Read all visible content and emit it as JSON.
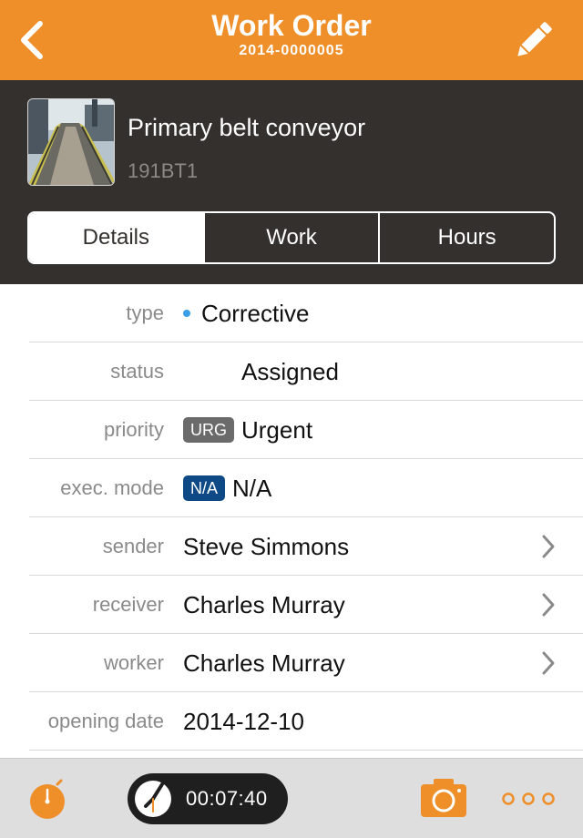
{
  "header": {
    "title": "Work Order",
    "subtitle": "2014-0000005",
    "back_icon": "chevron-left-icon",
    "edit_icon": "pencil-icon"
  },
  "asset": {
    "name": "Primary belt conveyor",
    "code": "191BT1",
    "image": "conveyor-photo"
  },
  "tabs": [
    {
      "label": "Details",
      "active": true
    },
    {
      "label": "Work",
      "active": false
    },
    {
      "label": "Hours",
      "active": false
    }
  ],
  "details": {
    "type": {
      "label": "type",
      "value": "Corrective"
    },
    "status": {
      "label": "status",
      "value": "Assigned"
    },
    "priority": {
      "label": "priority",
      "badge": "URG",
      "value": "Urgent"
    },
    "exec_mode": {
      "label": "exec. mode",
      "badge": "N/A",
      "value": "N/A"
    },
    "sender": {
      "label": "sender",
      "value": "Steve Simmons"
    },
    "receiver": {
      "label": "receiver",
      "value": "Charles Murray"
    },
    "worker": {
      "label": "worker",
      "value": "Charles Murray"
    },
    "opening_date": {
      "label": "opening date",
      "value": "2014-12-10"
    }
  },
  "toolbar": {
    "timer": "00:07:40",
    "icons": [
      "stopwatch-icon",
      "clock-icon",
      "camera-icon",
      "more-icon"
    ]
  },
  "colors": {
    "accent": "#ee8f2a",
    "panel": "#33302e",
    "type_dot": "#3a9ee8",
    "priority_badge": "#6b6b6b",
    "exec_badge": "#0f4a86",
    "toolbar": "#dedede"
  }
}
